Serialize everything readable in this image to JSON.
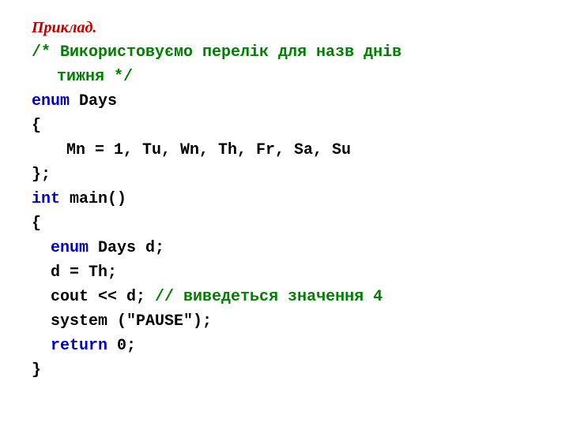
{
  "title": "Приклад.",
  "comment1a": "/* Використовуємо перелік для назв днів",
  "comment1b": "тижня */",
  "kw_enum": "enum",
  "enum_name": " Days",
  "brace_open": "{",
  "enum_body": "Mn = 1, Tu, Wn, Th, Fr, Sa, Su",
  "brace_close_semi": "};",
  "kw_int": "int",
  "main_sig": " main()",
  "brace_open2": "{",
  "kw_enum2": "enum",
  "decl": " Days d;",
  "assign": "d = Th;",
  "cout_pre": "cout << d; ",
  "comment_inline": "// виведеться значення 4",
  "pause": "system (\"PAUSE\");",
  "kw_return": "return",
  "return_rest": " 0;",
  "brace_close2": "}"
}
